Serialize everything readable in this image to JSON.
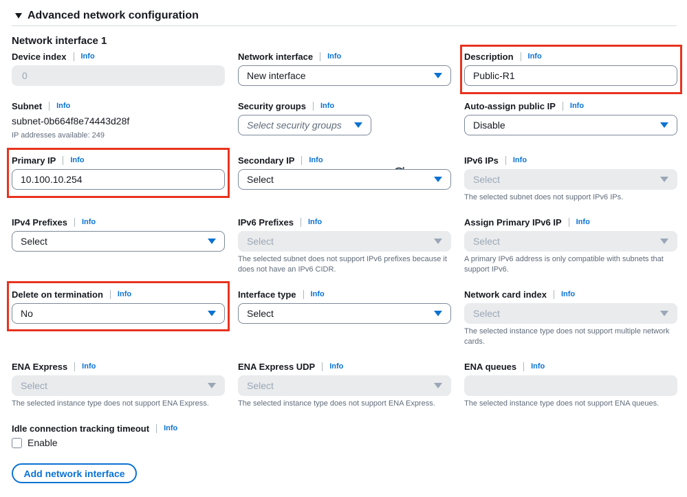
{
  "section": {
    "title": "Advanced network configuration"
  },
  "subsection": {
    "title": "Network interface 1"
  },
  "info_label": "Info",
  "fields": {
    "device_index": {
      "label": "Device index",
      "value": "0"
    },
    "network_interface": {
      "label": "Network interface",
      "value": "New interface"
    },
    "description": {
      "label": "Description",
      "value": "Public-R1"
    },
    "subnet": {
      "label": "Subnet",
      "value": "subnet-0b664f8e74443d28f",
      "help": "IP addresses available: 249"
    },
    "security_groups": {
      "label": "Security groups",
      "placeholder": "Select security groups"
    },
    "auto_assign_public_ip": {
      "label": "Auto-assign public IP",
      "value": "Disable"
    },
    "primary_ip": {
      "label": "Primary IP",
      "value": "10.100.10.254"
    },
    "secondary_ip": {
      "label": "Secondary IP",
      "value": "Select"
    },
    "ipv6_ips": {
      "label": "IPv6 IPs",
      "value": "Select",
      "help": "The selected subnet does not support IPv6 IPs."
    },
    "ipv4_prefixes": {
      "label": "IPv4 Prefixes",
      "value": "Select"
    },
    "ipv6_prefixes": {
      "label": "IPv6 Prefixes",
      "value": "Select",
      "help": "The selected subnet does not support IPv6 prefixes because it does not have an IPv6 CIDR."
    },
    "assign_primary_ipv6": {
      "label": "Assign Primary IPv6 IP",
      "value": "Select",
      "help": "A primary IPv6 address is only compatible with subnets that support IPv6."
    },
    "delete_on_termination": {
      "label": "Delete on termination",
      "value": "No"
    },
    "interface_type": {
      "label": "Interface type",
      "value": "Select"
    },
    "network_card_index": {
      "label": "Network card index",
      "value": "Select",
      "help": "The selected instance type does not support multiple network cards."
    },
    "ena_express": {
      "label": "ENA Express",
      "value": "Select",
      "help": "The selected instance type does not support ENA Express."
    },
    "ena_express_udp": {
      "label": "ENA Express UDP",
      "value": "Select",
      "help": "The selected instance type does not support ENA Express."
    },
    "ena_queues": {
      "label": "ENA queues",
      "value": "",
      "help": "The selected instance type does not support ENA queues."
    },
    "idle_timeout": {
      "label": "Idle connection tracking timeout",
      "checkbox_label": "Enable",
      "checked": false
    }
  },
  "buttons": {
    "add_network_interface": "Add network interface"
  },
  "colors": {
    "accent": "#0972d3",
    "highlight": "#e8321e",
    "disabled_bg": "#e9ebed"
  }
}
